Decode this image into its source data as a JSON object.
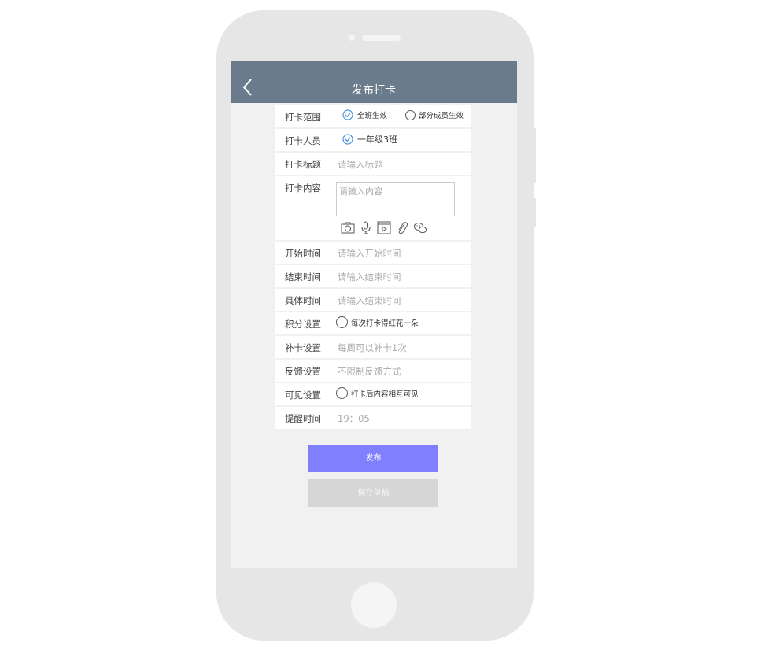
{
  "header": {
    "title": "发布打卡"
  },
  "form": {
    "scope": {
      "label": "打卡范围",
      "option_all": "全班生效",
      "option_part": "部分成员生效"
    },
    "members": {
      "label": "打卡人员",
      "value": "一年级3班"
    },
    "title": {
      "label": "打卡标题",
      "placeholder": "请输入标题"
    },
    "content": {
      "label": "打卡内容",
      "placeholder": "请输入内容"
    },
    "start_time": {
      "label": "开始时间",
      "placeholder": "请输入开始时间"
    },
    "end_time": {
      "label": "结束时间",
      "placeholder": "请输入结束时间"
    },
    "specific_time": {
      "label": "具体时间",
      "placeholder": "请输入结束时间"
    },
    "points": {
      "label": "积分设置",
      "option": "每次打卡得红花一朵"
    },
    "makeup": {
      "label": "补卡设置",
      "value": "每周可以补卡1次"
    },
    "feedback": {
      "label": "反馈设置",
      "value": "不限制反馈方式"
    },
    "visibility": {
      "label": "可见设置",
      "option": "打卡后内容相互可见"
    },
    "reminder": {
      "label": "提醒时间",
      "value": "19：05"
    }
  },
  "buttons": {
    "publish": "发布",
    "save_draft": "保存草稿"
  },
  "icons": [
    "camera-icon",
    "microphone-icon",
    "video-icon",
    "attachment-icon",
    "wechat-icon"
  ],
  "colors": {
    "header": "#6a7c8c",
    "primary": "#8080ff",
    "check": "#4a90e2"
  }
}
